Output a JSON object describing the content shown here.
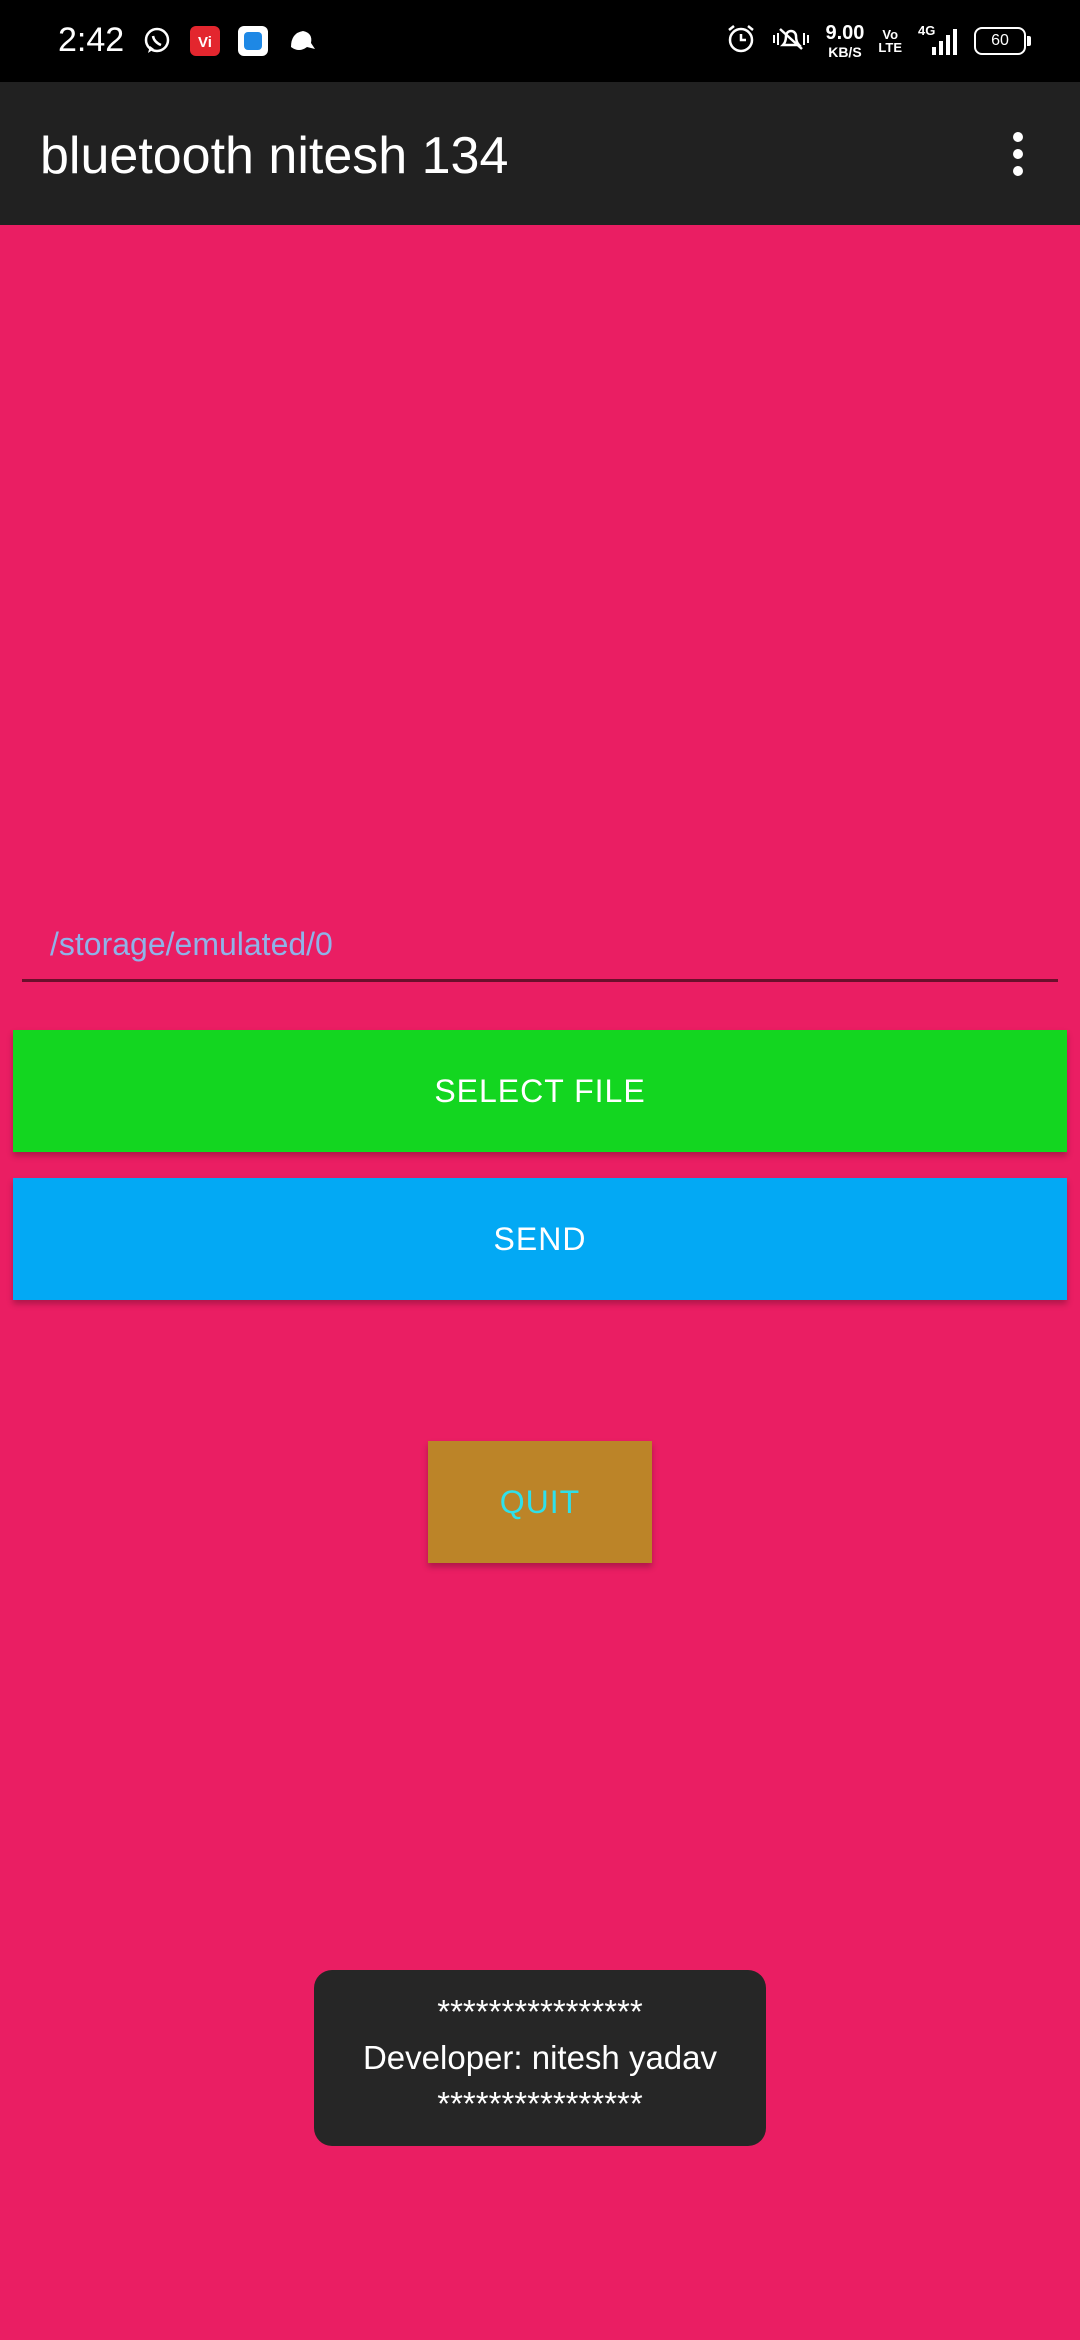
{
  "status_bar": {
    "time": "2:42",
    "speed_value": "9.00",
    "speed_unit": "KB/S",
    "volte_top": "Vo",
    "volte_bottom": "LTE",
    "network": "4G",
    "battery": "60",
    "icons": [
      "whatsapp-icon",
      "vi-icon",
      "app-icon",
      "notification-icon",
      "alarm-icon",
      "mute-vibrate-icon",
      "signal-icon"
    ]
  },
  "app_bar": {
    "title": "bluetooth nitesh 134",
    "menu_icon": "overflow-menu-icon"
  },
  "path_input": {
    "value": "/storage/emulated/0"
  },
  "buttons": {
    "select_file": "SELECT FILE",
    "send": "SEND",
    "quit": "QUIT"
  },
  "toast": {
    "line1": "****************",
    "line2": "Developer: nitesh yadav",
    "line3": "****************"
  },
  "colors": {
    "background": "#EA1E63",
    "app_bar": "#212121",
    "select_button": "#13D620",
    "send_button": "#03A9F4",
    "quit_button": "#BC8428",
    "quit_text": "#2FE0EA",
    "toast": "#262626"
  }
}
